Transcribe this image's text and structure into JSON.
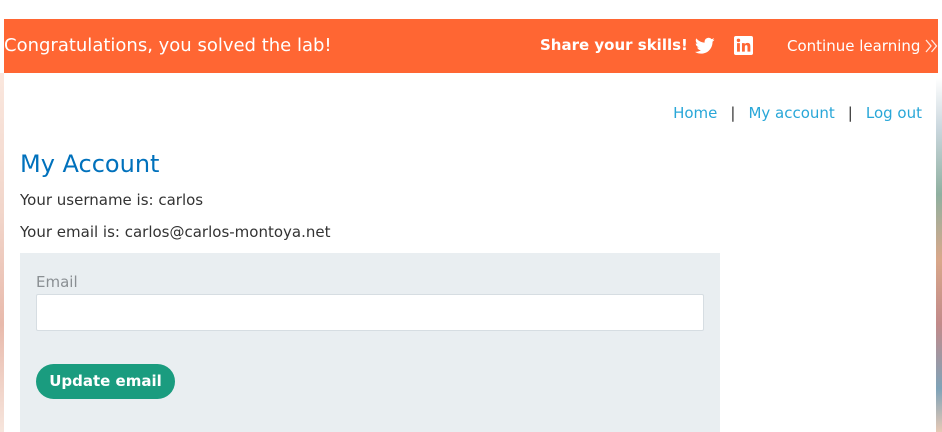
{
  "banner": {
    "title": "Congratulations, you solved the lab!",
    "share_label": "Share your skills!",
    "continue_label": "Continue learning",
    "icons": [
      "twitter-icon",
      "linkedin-icon",
      "chevron-double-icon"
    ],
    "background_color": "#ff6633",
    "text_color": "#ffffff"
  },
  "nav": {
    "home": "Home",
    "separator_1": "|",
    "my_account": "My account",
    "separator_2": "|",
    "log_out": "Log out",
    "link_color": "#29a7d8"
  },
  "account": {
    "title": "My Account",
    "title_color": "#0071bc",
    "username_line": "Your username is: carlos",
    "email_line": "Your email is: carlos@carlos-montoya.net"
  },
  "form": {
    "email_label": "Email",
    "email_value": "",
    "update_button_label": "Update email",
    "button_color": "#1a9c7f",
    "panel_color": "#e9eef1"
  }
}
